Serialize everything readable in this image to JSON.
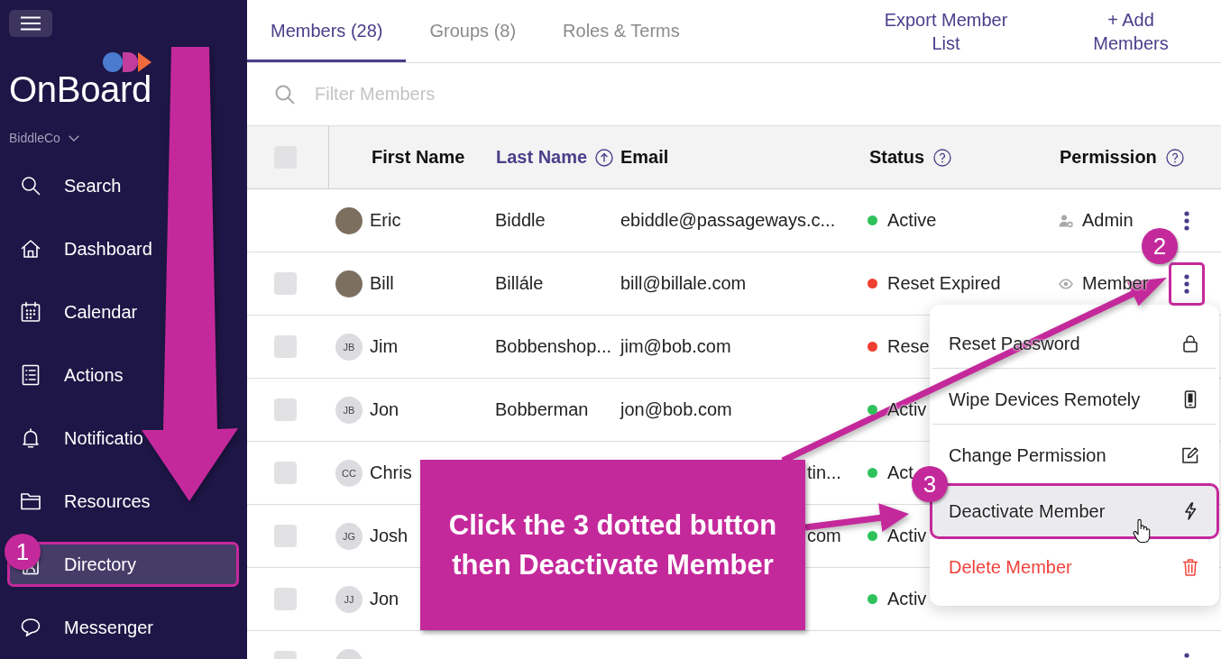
{
  "sidebar": {
    "logo": "OnBoard",
    "organization": "BiddleCo",
    "items": [
      {
        "label": "Search",
        "selected": false
      },
      {
        "label": "Dashboard",
        "selected": false
      },
      {
        "label": "Calendar",
        "selected": false
      },
      {
        "label": "Actions",
        "selected": false
      },
      {
        "label": "Notificatio",
        "selected": false
      },
      {
        "label": "Resources",
        "selected": false
      },
      {
        "label": "Directory",
        "selected": true
      },
      {
        "label": "Messenger",
        "selected": false
      }
    ]
  },
  "tabs": [
    {
      "label": "Members (28)",
      "selected": true
    },
    {
      "label": "Groups (8)",
      "selected": false
    },
    {
      "label": "Roles & Terms",
      "selected": false
    }
  ],
  "header_actions": [
    {
      "label": "Export Member List"
    },
    {
      "label": "+ Add Members"
    }
  ],
  "filter": {
    "placeholder": "Filter Members"
  },
  "table": {
    "select_all": {
      "checked": false
    },
    "columns": [
      {
        "label": "First Name",
        "sorted": false,
        "help": false
      },
      {
        "label": "Last Name",
        "sorted": true,
        "help": false
      },
      {
        "label": "Email",
        "sorted": false,
        "help": false
      },
      {
        "label": "Status",
        "sorted": false,
        "help": true
      },
      {
        "label": "Permission",
        "sorted": false,
        "help": true
      }
    ],
    "rows": [
      {
        "avatar": {
          "kind": "photo"
        },
        "first_name": "Eric",
        "last_name": "Biddle",
        "email": "ebiddle@passageways.c...",
        "status": {
          "label": "Active",
          "color": "#2fc25b"
        },
        "permission": {
          "kind": "admin",
          "label": "Admin"
        },
        "more_button": {
          "highlighted": false
        }
      },
      {
        "checked": false,
        "avatar": {
          "kind": "photo"
        },
        "first_name": "Bill",
        "last_name": "Billále",
        "email": "bill@billale.com",
        "status": {
          "label": "Reset Expired",
          "color": "#f03e2f"
        },
        "permission": {
          "kind": "member",
          "label": "Member"
        },
        "more_button": {
          "highlighted": true
        }
      },
      {
        "checked": false,
        "avatar": {
          "kind": "initials",
          "initials": "JB"
        },
        "first_name": "Jim",
        "last_name": "Bobbenshop...",
        "email": "jim@bob.com",
        "status": {
          "label": "Rese",
          "color": "#f03e2f"
        }
      },
      {
        "checked": false,
        "avatar": {
          "kind": "initials",
          "initials": "JB"
        },
        "first_name": "Jon",
        "last_name": "Bobberman",
        "email": "jon@bob.com",
        "status": {
          "label": "Activ",
          "color": "#2fc25b"
        }
      },
      {
        "checked": false,
        "avatar": {
          "kind": "initials",
          "initials": "CC"
        },
        "first_name": "Chris",
        "email_tail": "tin...",
        "status": {
          "label": "Act",
          "color": "#2fc25b"
        }
      },
      {
        "checked": false,
        "avatar": {
          "kind": "initials",
          "initials": "JG"
        },
        "first_name": "Josh",
        "email_tail": "com",
        "status": {
          "label": "Activ",
          "color": "#2fc25b"
        }
      },
      {
        "checked": false,
        "avatar": {
          "kind": "initials",
          "initials": "JJ"
        },
        "first_name": "Jon",
        "status": {
          "label": "Activ",
          "color": "#2fc25b"
        }
      },
      {
        "checked": false,
        "avatar": {
          "kind": "blank"
        },
        "more_button": {
          "highlighted": false
        }
      }
    ]
  },
  "context_menu": {
    "items": [
      {
        "label": "Reset Password",
        "kind": "normal",
        "selected": false
      },
      {
        "label": "Wipe Devices Remotely",
        "kind": "normal",
        "selected": false
      },
      {
        "label": "Change Permission",
        "kind": "normal",
        "selected": false
      },
      {
        "label": "Deactivate Member",
        "kind": "normal",
        "selected": true
      },
      {
        "label": "Delete Member",
        "kind": "danger",
        "selected": false
      }
    ]
  },
  "annotations": {
    "callout": "Click the 3 dotted button\nthen Deactivate Member",
    "badges": [
      {
        "label": "1"
      },
      {
        "label": "2"
      },
      {
        "label": "3"
      }
    ]
  }
}
